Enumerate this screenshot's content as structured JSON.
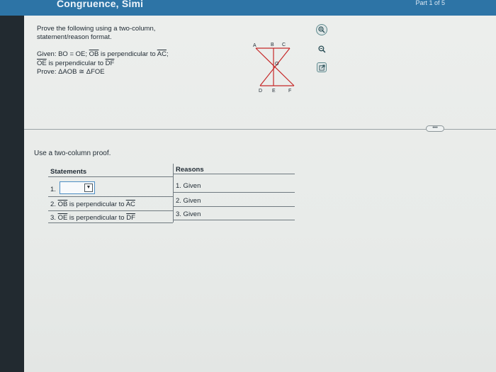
{
  "header": {
    "title": "Congruence, Simi",
    "part": "Part 1 of 5"
  },
  "problem": {
    "instruction": "Prove the following using a two-column, statement/reason format.",
    "given_prefix": "Given: BO = OE; ",
    "given_ob": "OB",
    "given_perp": " is perpendicular to ",
    "given_ac": "AC",
    "given_semicolon": ";",
    "given2_oe": "OE",
    "given2_perp": " is perpendicular to ",
    "given2_df": "DF",
    "prove": "Prove: ΔAOB ≅ ΔFOE"
  },
  "figure": {
    "labels": [
      "A",
      "B",
      "C",
      "O",
      "D",
      "E",
      "F"
    ]
  },
  "tools": {
    "zoom_in_icon": "zoom-in-icon",
    "zoom_out_icon": "zoom-out-icon",
    "popout_icon": "popout-icon"
  },
  "more_button": "•••",
  "section": {
    "use_text": "Use a two-column proof."
  },
  "table": {
    "headers": {
      "statements": "Statements",
      "reasons": "Reasons"
    },
    "rows": [
      {
        "num": "1.",
        "statement": "",
        "reason": "1. Given"
      },
      {
        "num": "2.",
        "statement_pre": "2. ",
        "statement_a": "OB",
        "statement_mid": " is perpendicular to ",
        "statement_b": "AC",
        "reason": "2. Given"
      },
      {
        "num": "3.",
        "statement_pre": "3. ",
        "statement_a": "OE",
        "statement_mid": " is perpendicular to ",
        "statement_b": "DF",
        "reason": "3. Given"
      }
    ]
  },
  "colors": {
    "header": "#2d74a6",
    "figure_lines": "#c62828"
  }
}
